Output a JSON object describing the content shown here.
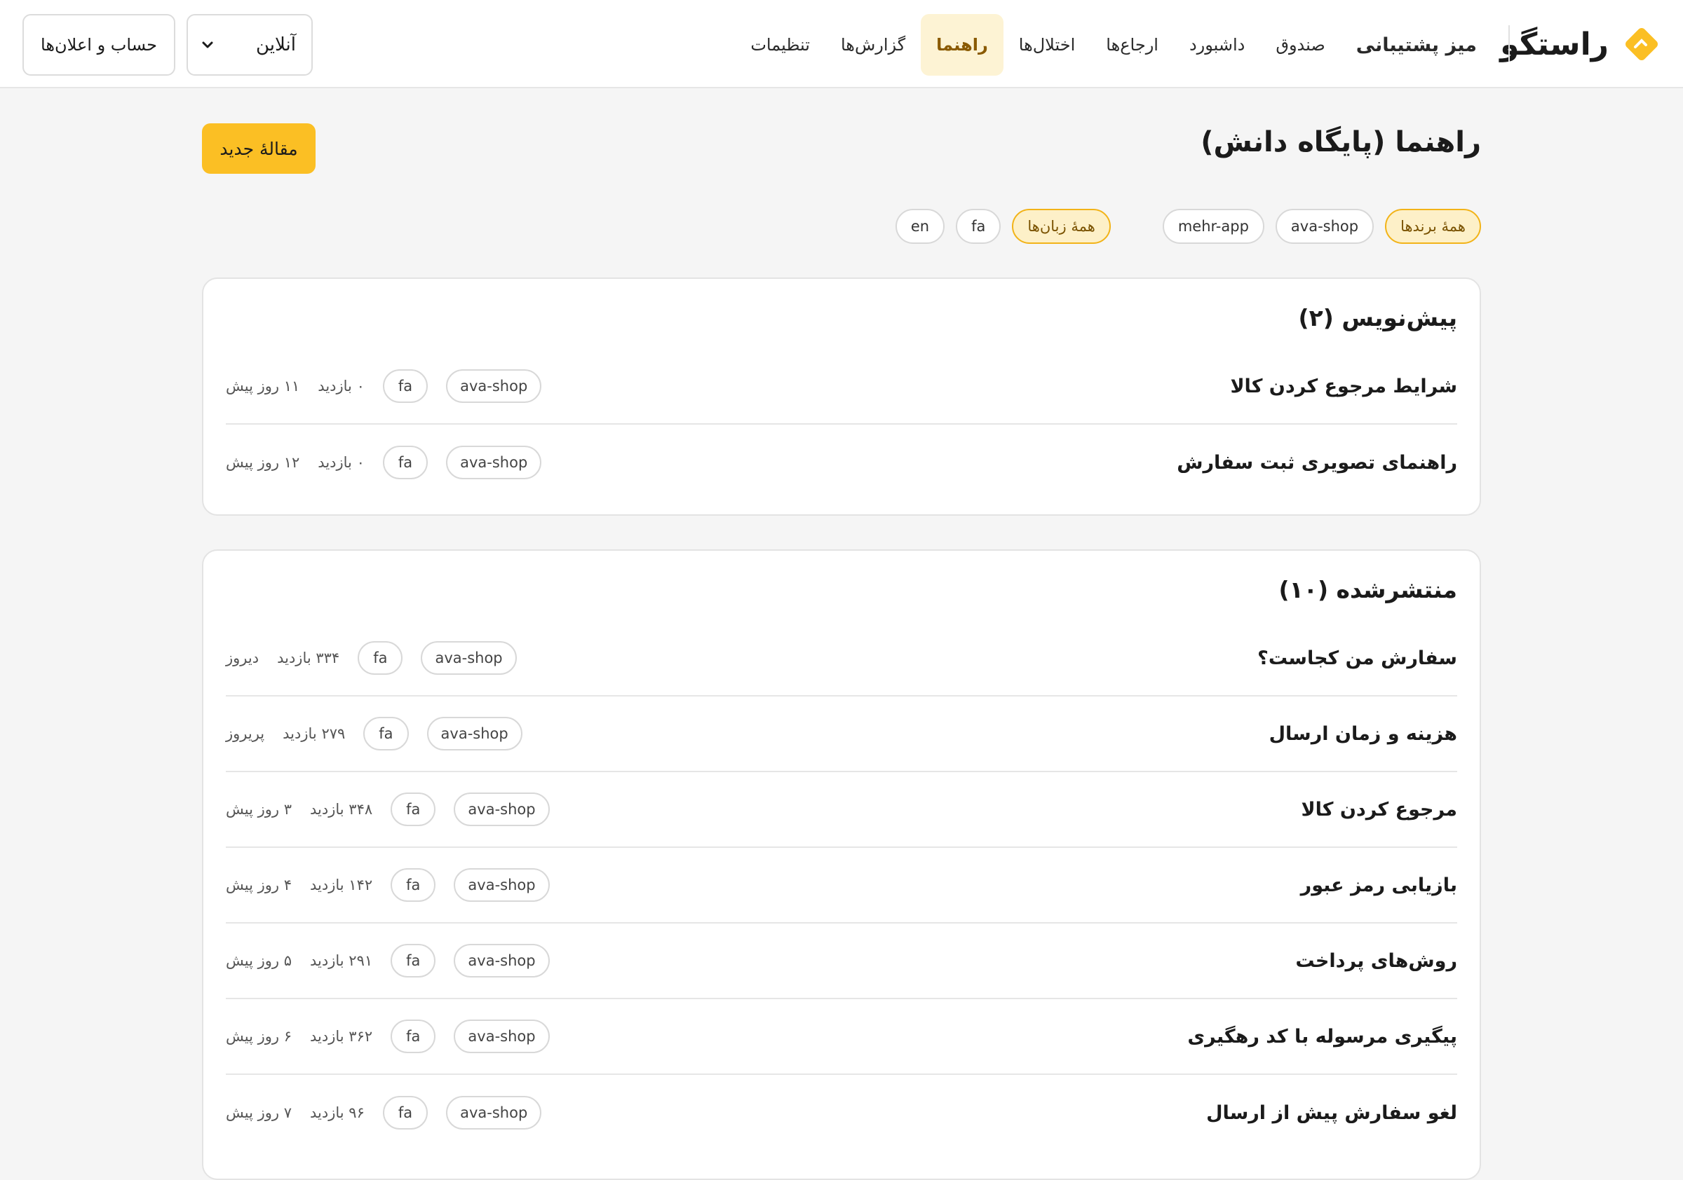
{
  "brand": {
    "name": "راستگو",
    "accent": "#fbbf24"
  },
  "nav": {
    "app_name": "میز پشتیبانی",
    "items": [
      {
        "label": "صندوق"
      },
      {
        "label": "داشبورد"
      },
      {
        "label": "ارجاع‌ها"
      },
      {
        "label": "اختلال‌ها"
      },
      {
        "label": "راهنما"
      },
      {
        "label": "گزارش‌ها"
      },
      {
        "label": "تنظیمات"
      }
    ],
    "active": "راهنما"
  },
  "status_select": {
    "value": "آنلاین"
  },
  "account_button": {
    "label": "حساب و اعلان‌ها"
  },
  "page": {
    "title": "راهنما (پایگاه دانش)",
    "new_button": "مقالهٔ جدید"
  },
  "filters": {
    "brands": [
      {
        "label": "همهٔ برندها",
        "active": true
      },
      {
        "label": "ava-shop",
        "active": false
      },
      {
        "label": "mehr-app",
        "active": false
      }
    ],
    "languages": [
      {
        "label": "همهٔ زبان‌ها",
        "active": true
      },
      {
        "label": "fa",
        "active": false
      },
      {
        "label": "en",
        "active": false
      }
    ]
  },
  "drafts": {
    "title": "پیش‌نویس (۲)",
    "articles": [
      {
        "title": "شرایط مرجوع کردن کالا",
        "brand": "ava-shop",
        "lang": "fa",
        "views": "۰ بازدید",
        "date": "۱۱ روز پیش"
      },
      {
        "title": "راهنمای تصویری ثبت سفارش",
        "brand": "ava-shop",
        "lang": "fa",
        "views": "۰ بازدید",
        "date": "۱۲ روز پیش"
      }
    ]
  },
  "published": {
    "title": "منتشرشده (۱۰)",
    "articles": [
      {
        "title": "سفارش من کجاست؟",
        "brand": "ava-shop",
        "lang": "fa",
        "views": "۳۳۴ بازدید",
        "date": "دیروز"
      },
      {
        "title": "هزینه و زمان ارسال",
        "brand": "ava-shop",
        "lang": "fa",
        "views": "۲۷۹ بازدید",
        "date": "پریروز"
      },
      {
        "title": "مرجوع کردن کالا",
        "brand": "ava-shop",
        "lang": "fa",
        "views": "۳۴۸ بازدید",
        "date": "۳ روز پیش"
      },
      {
        "title": "بازیابی رمز عبور",
        "brand": "ava-shop",
        "lang": "fa",
        "views": "۱۴۲ بازدید",
        "date": "۴ روز پیش"
      },
      {
        "title": "روش‌های پرداخت",
        "brand": "ava-shop",
        "lang": "fa",
        "views": "۲۹۱ بازدید",
        "date": "۵ روز پیش"
      },
      {
        "title": "پیگیری مرسوله با کد رهگیری",
        "brand": "ava-shop",
        "lang": "fa",
        "views": "۳۶۲ بازدید",
        "date": "۶ روز پیش"
      },
      {
        "title": "لغو سفارش پیش از ارسال",
        "brand": "ava-shop",
        "lang": "fa",
        "views": "۹۶ بازدید",
        "date": "۷ روز پیش"
      }
    ]
  }
}
